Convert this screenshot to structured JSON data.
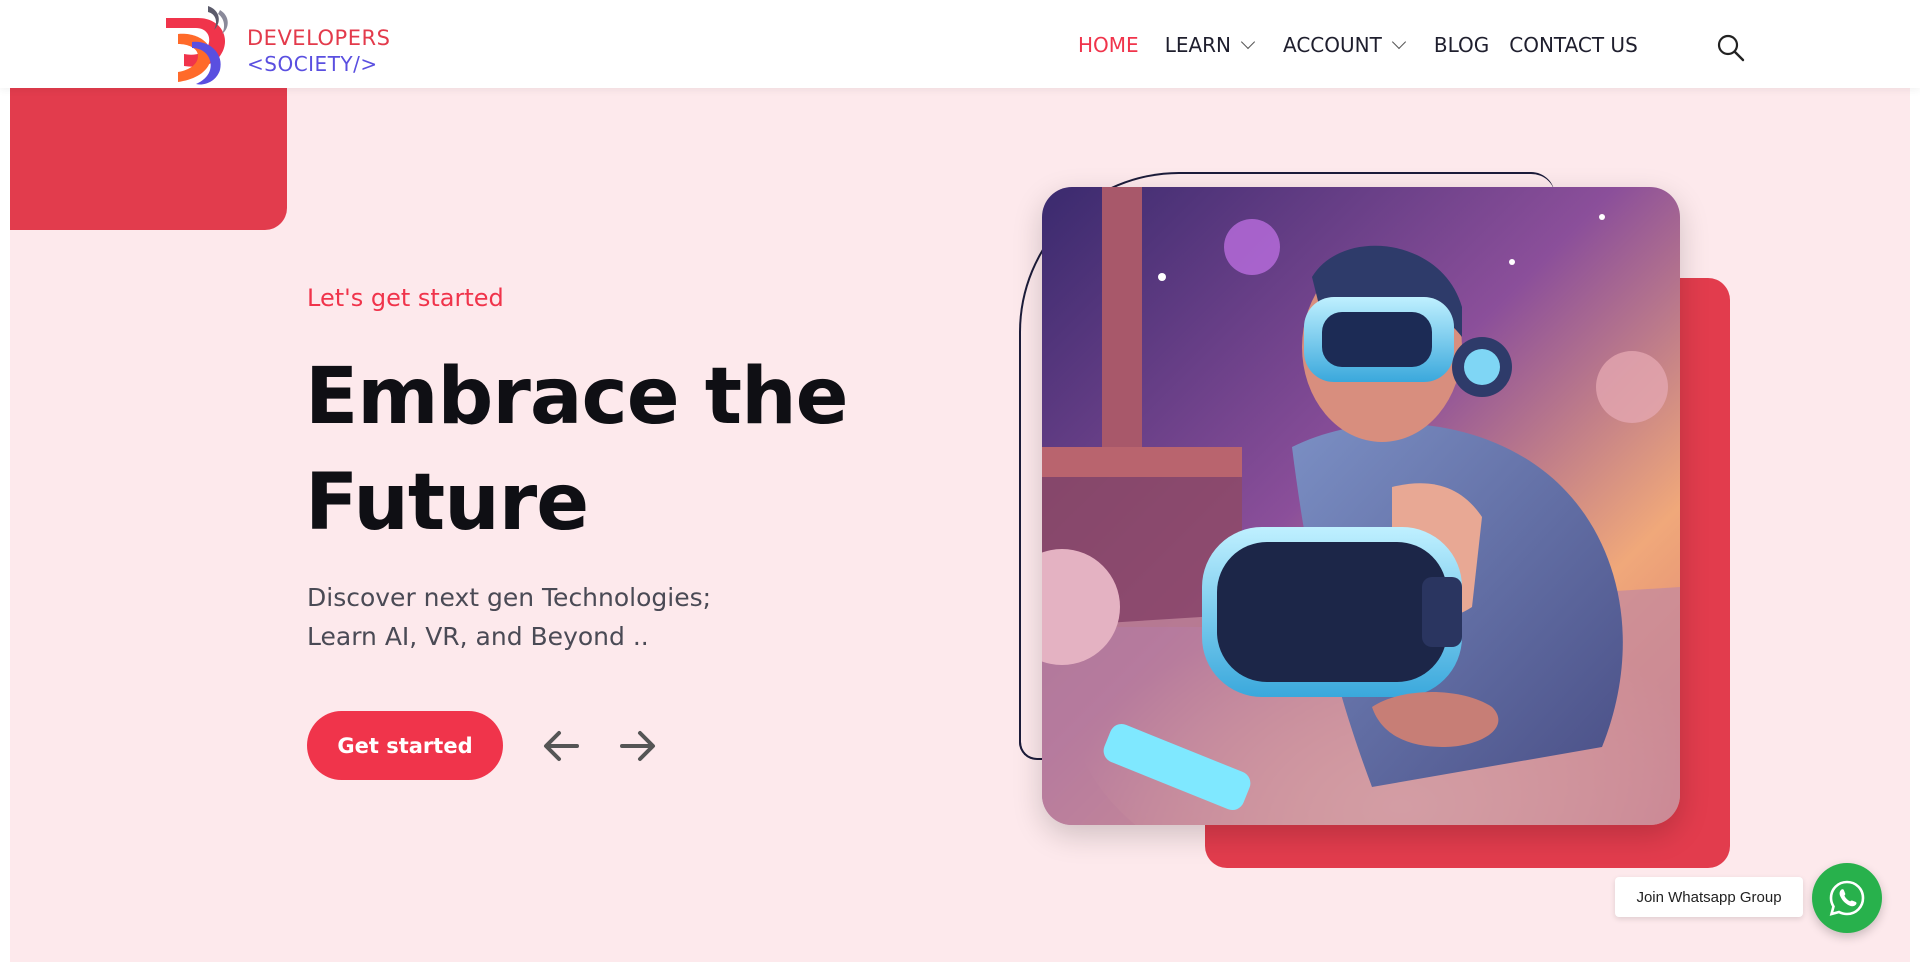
{
  "brand": {
    "line1": "DEVELOPERS",
    "line2": "<SOCIETY/>",
    "primary_color": "#e33a4b",
    "secondary_color": "#5a4fe0"
  },
  "nav": {
    "items": [
      {
        "label": "HOME",
        "active": true,
        "has_dropdown": false
      },
      {
        "label": "LEARN",
        "active": false,
        "has_dropdown": true
      },
      {
        "label": "ACCOUNT",
        "active": false,
        "has_dropdown": true
      },
      {
        "label": "BLOG",
        "active": false,
        "has_dropdown": false
      },
      {
        "label": "CONTACT US",
        "active": false,
        "has_dropdown": false
      }
    ],
    "search_icon": "search-icon"
  },
  "hero": {
    "kicker": "Let's get started",
    "headline_line1": "Embrace the",
    "headline_line2": "Future",
    "sub_line1": "Discover next gen Technologies;",
    "sub_line2": "Learn AI, VR, and Beyond ..",
    "cta_label": "Get started",
    "prev_icon": "arrow-left-icon",
    "next_icon": "arrow-right-icon",
    "image_subject": "person wearing VR headset",
    "accent_color": "#f0344b",
    "background_color": "#fde9ec"
  },
  "whatsapp": {
    "label": "Join Whatsapp Group",
    "icon": "whatsapp-icon",
    "color": "#28b14c"
  }
}
